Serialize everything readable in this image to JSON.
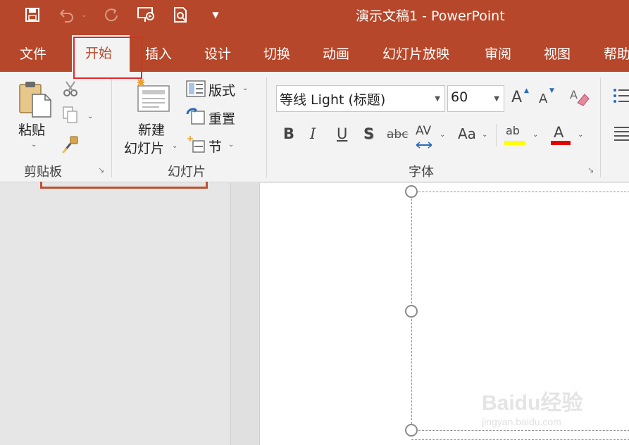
{
  "window": {
    "title": "演示文稿1  -  PowerPoint",
    "accent": "#b7472a"
  },
  "quick_access": [
    {
      "name": "save-icon",
      "glyph": "🖫"
    },
    {
      "name": "undo-icon",
      "glyph": "↶"
    },
    {
      "name": "redo-icon",
      "glyph": "↻"
    },
    {
      "name": "present-icon",
      "glyph": "🖵"
    },
    {
      "name": "print-preview-icon",
      "glyph": "🔍"
    },
    {
      "name": "customize-qa-icon",
      "glyph": "▾"
    }
  ],
  "tabs": [
    "文件",
    "开始",
    "插入",
    "设计",
    "切换",
    "动画",
    "幻灯片放映",
    "审阅",
    "视图",
    "帮助"
  ],
  "active_tab": "开始",
  "ribbon": {
    "clipboard": {
      "label": "剪贴板",
      "paste": "粘贴"
    },
    "slides": {
      "label": "幻灯片",
      "new_slide_1": "新建",
      "new_slide_2": "幻灯片",
      "layout": "版式",
      "reset": "重置",
      "section": "节"
    },
    "font": {
      "label": "字体",
      "font_name": "等线 Light (标题)",
      "font_size": "60",
      "grow": "A",
      "shrink": "A",
      "bold": "B",
      "italic": "I",
      "underline": "U",
      "shadow": "S",
      "strike": "abc",
      "spacing": "AV",
      "case": "Aa",
      "highlight": "ab",
      "font_color": "A",
      "highlight_color": "#ffff00",
      "font_color_value": "#e00000"
    }
  },
  "watermark": {
    "logo": "Baidu经验",
    "url": "jingyan.baidu.com"
  }
}
